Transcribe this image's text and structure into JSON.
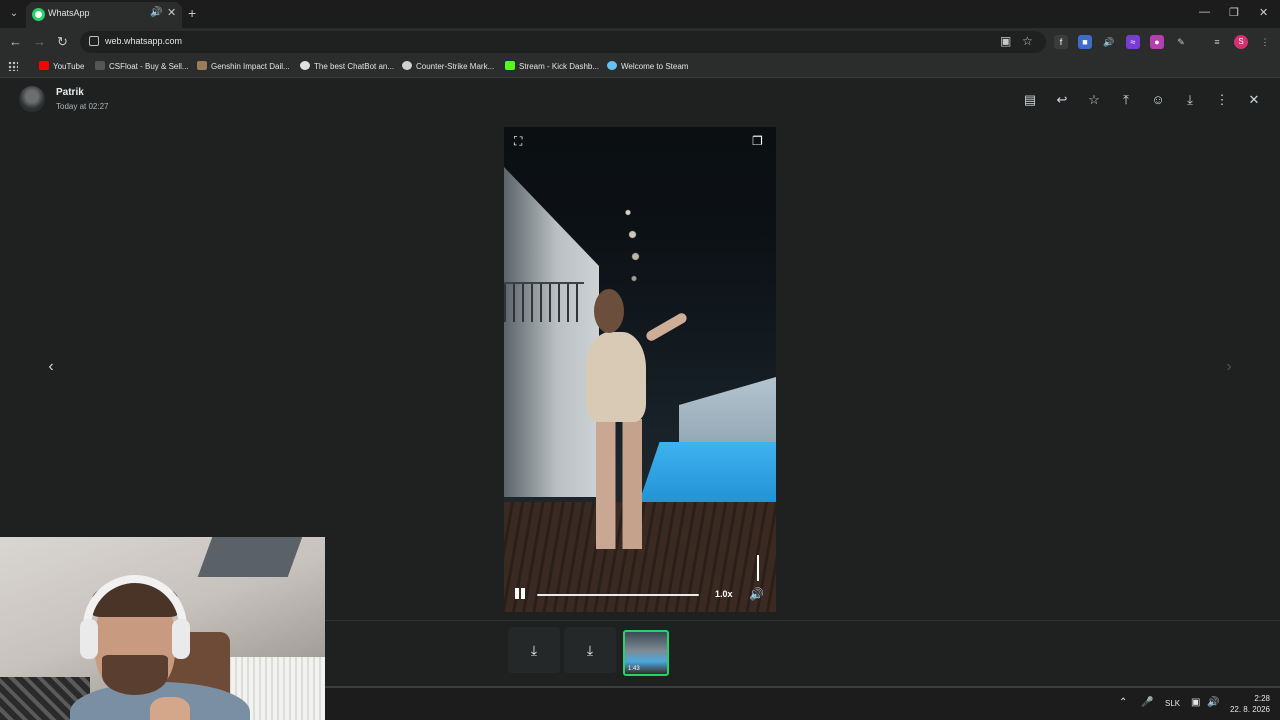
{
  "browser": {
    "tab_title": "WhatsApp",
    "url": "web.whatsapp.com",
    "bookmarks": [
      {
        "label": "YouTube",
        "color": "#ff0000"
      },
      {
        "label": "CSFloat - Buy & Sell...",
        "color": "#bbbbbb"
      },
      {
        "label": "Genshin Impact Dail...",
        "color": "#9a7b5a"
      },
      {
        "label": "The best ChatBot an...",
        "color": "#e0e0e0"
      },
      {
        "label": "Counter-Strike Mark...",
        "color": "#d0d0d0"
      },
      {
        "label": "Stream - Kick Dashb...",
        "color": "#53fc18"
      },
      {
        "label": "Welcome to Steam",
        "color": "#66c0f4"
      }
    ],
    "profile_initial": "S"
  },
  "viewer": {
    "sender_name": "Patrik",
    "timestamp": "Today at 02:27",
    "header_icons": [
      "message-icon",
      "reply-icon",
      "star-icon",
      "pin-icon",
      "emoji-icon",
      "download-icon",
      "more-icon",
      "close-icon"
    ],
    "player": {
      "speed": "1.0x",
      "progress_fraction": 0.0,
      "state": "playing"
    },
    "thumbnail_duration": "1:43"
  },
  "taskbar": {
    "language": "SLK",
    "time": "2:28",
    "date": "22. 8. 2026"
  },
  "colors": {
    "accent": "#25d366",
    "background": "#1f2120"
  }
}
